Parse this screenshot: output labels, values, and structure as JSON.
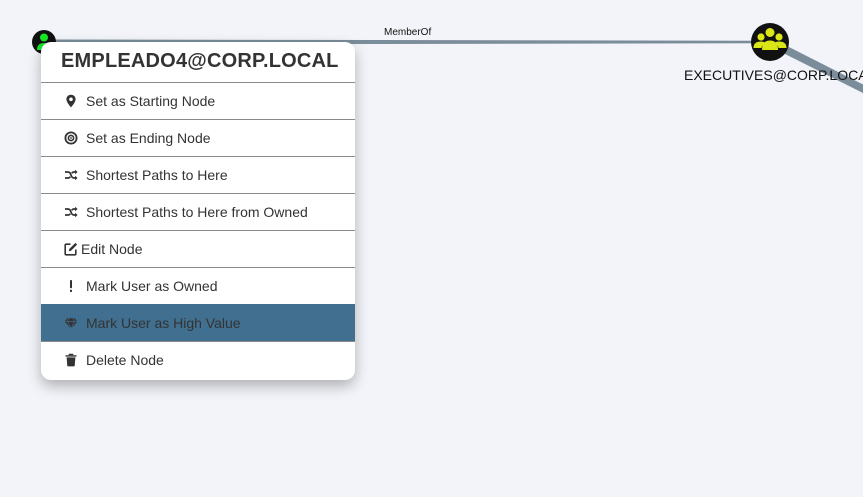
{
  "graph": {
    "nodes": [
      {
        "label": "EMPLEADO4@CORP.LOCAL",
        "type": "user",
        "icon": "user-icon",
        "color": "#17e625"
      },
      {
        "label": "EXECUTIVES@CORP.LOCAL",
        "type": "group",
        "icon": "group-icon",
        "color": "#dbe617"
      }
    ],
    "edges": [
      {
        "label": "MemberOf",
        "from": "EMPLEADO4@CORP.LOCAL",
        "to": "EXECUTIVES@CORP.LOCAL"
      }
    ],
    "edge_color": "#7b8d9a"
  },
  "context_menu": {
    "title": "EMPLEADO4@CORP.LOCAL",
    "items": [
      {
        "label": "Set as Starting Node",
        "icon": "map-marker-icon"
      },
      {
        "label": "Set as Ending Node",
        "icon": "bullseye-icon"
      },
      {
        "label": "Shortest Paths to Here",
        "icon": "random-icon"
      },
      {
        "label": "Shortest Paths to Here from Owned",
        "icon": "random-icon"
      },
      {
        "label": "Edit Node",
        "icon": "edit-icon"
      },
      {
        "label": "Mark User as Owned",
        "icon": "exclamation-icon"
      },
      {
        "label": "Mark User as High Value",
        "icon": "gem-icon",
        "highlighted": true
      },
      {
        "label": "Delete Node",
        "icon": "trash-icon"
      }
    ],
    "highlight_color": "#406f8f"
  }
}
